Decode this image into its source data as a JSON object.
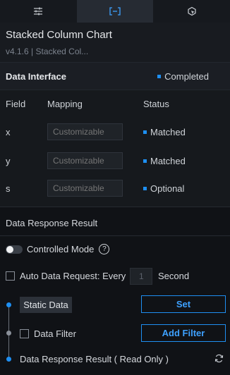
{
  "tabs": [
    {
      "icon": "sliders-icon",
      "active": false
    },
    {
      "icon": "data-bracket-icon",
      "active": true
    },
    {
      "icon": "interaction-icon",
      "active": false
    }
  ],
  "header": {
    "title": "Stacked Column Chart",
    "subtitle": "v4.1.6 | Stacked Col..."
  },
  "data_interface": {
    "label": "Data Interface",
    "status": "Completed",
    "status_color": "#1e8ff2"
  },
  "mapping_table": {
    "headers": {
      "field": "Field",
      "mapping": "Mapping",
      "status": "Status"
    },
    "rows": [
      {
        "field": "x",
        "placeholder": "Customizable",
        "status": "Matched"
      },
      {
        "field": "y",
        "placeholder": "Customizable",
        "status": "Matched"
      },
      {
        "field": "s",
        "placeholder": "Customizable",
        "status": "Optional"
      }
    ]
  },
  "response": {
    "title": "Data Response Result",
    "controlled_mode_label": "Controlled Mode",
    "controlled_mode_on": false,
    "help_glyph": "?",
    "auto_request_label": "Auto Data Request: Every",
    "auto_request_checked": false,
    "interval_value": "1",
    "interval_unit": "Second"
  },
  "flow": {
    "static_data_label": "Static Data",
    "set_button": "Set",
    "data_filter_label": "Data Filter",
    "add_filter_button": "Add Filter",
    "response_readonly_label": "Data Response Result ( Read Only )"
  },
  "colors": {
    "accent": "#1e8ff2",
    "background": "#101216"
  }
}
